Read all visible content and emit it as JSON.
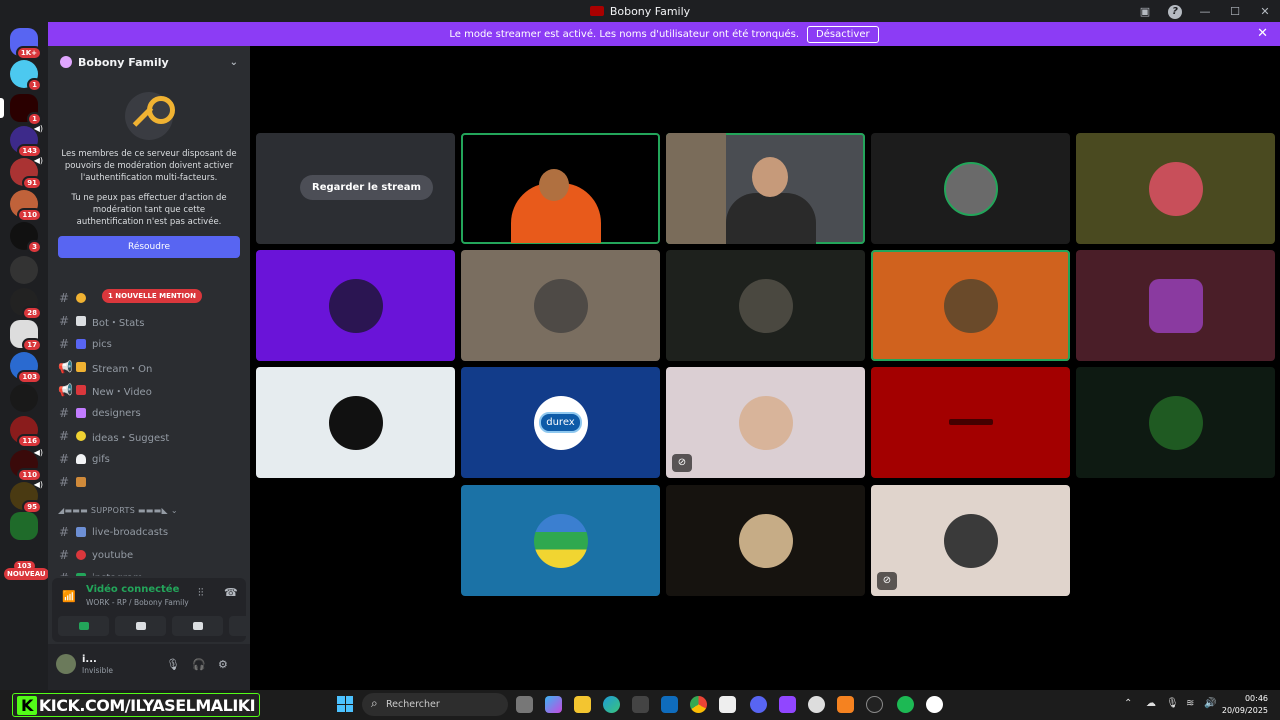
{
  "window": {
    "title": "Bobony Family"
  },
  "banner": {
    "message": "Le mode streamer est activé. Les noms d'utilisateur ont été tronqués.",
    "button": "Désactiver"
  },
  "rail": {
    "badges": [
      "1K+",
      "1",
      "1",
      "143",
      "91",
      "110",
      "3",
      "28",
      "17",
      "103",
      "116",
      "110",
      "95",
      "103"
    ],
    "nouveau": "NOUVEAU"
  },
  "server": {
    "name": "Bobony Family",
    "mfa_text_1": "Les membres de ce serveur disposant de pouvoirs de modération doivent activer l'authentification multi-facteurs.",
    "mfa_text_2": "Tu ne peux pas effectuer d'action de modération tant que cette authentification n'est pas activée.",
    "resolve_button": "Résoudre"
  },
  "mention_badge": "1 NOUVELLE MENTION",
  "channels": [
    {
      "name": "",
      "emoji_color": "#f0b232"
    },
    {
      "name": "Bot・Stats",
      "emoji_color": "#dbdee1"
    },
    {
      "name": "pics",
      "emoji_color": "#5865f2"
    },
    {
      "name": "Stream・On",
      "emoji_color": "#f0b232"
    },
    {
      "name": "New・Video",
      "emoji_color": "#da373c"
    },
    {
      "name": "designers",
      "emoji_color": "#c27cff"
    },
    {
      "name": "ideas・Suggest",
      "emoji_color": "#f0d232"
    },
    {
      "name": "gifs",
      "emoji_color": "#f2f3f5"
    },
    {
      "name": "",
      "emoji_color": "#d08a3a"
    }
  ],
  "category": "◢▬▬▬ SUPPORTS ▬▬▬◣",
  "support_channels": [
    {
      "name": "live-broadcasts",
      "emoji_color": "#6d8fd4"
    },
    {
      "name": "youtube",
      "emoji_color": "#da373c"
    },
    {
      "name": "instagram",
      "emoji_color": "#23a55a"
    }
  ],
  "voice": {
    "status": "Vidéo connectée",
    "channel": "WORK - RP / Bobony Family"
  },
  "user": {
    "name": "i...",
    "status": "Invisible"
  },
  "stream_tile": {
    "button": "Regarder le stream"
  },
  "durex_label": "durex",
  "taskbar": {
    "search_placeholder": "Rechercher",
    "kick_text": "KICK.COM/ILYASELMALIKI",
    "kick_letter": "K",
    "time": "00:46",
    "date": "20/09/2025"
  },
  "colors": {
    "accent": "#5865f2",
    "banner": "#8c3cf5",
    "speaking": "#23a55a",
    "mention": "#da373c"
  }
}
